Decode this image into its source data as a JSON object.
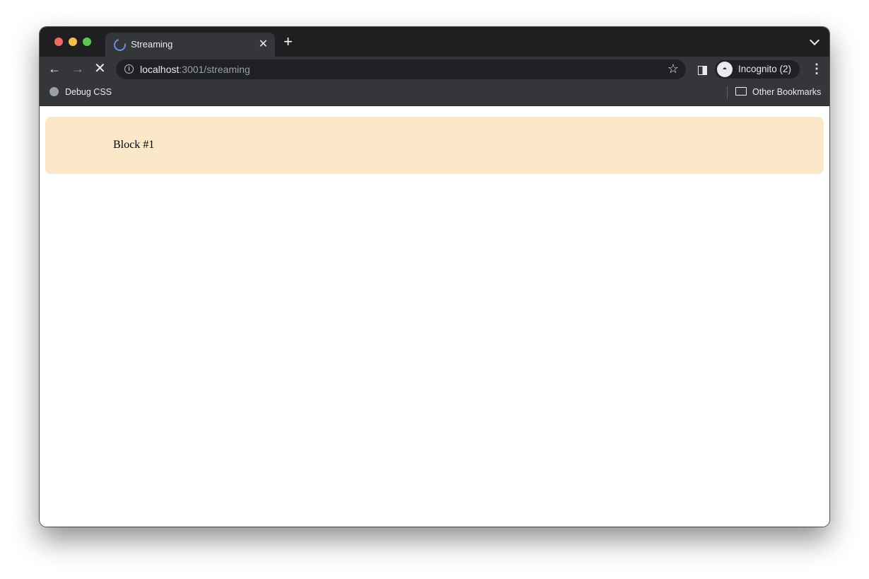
{
  "browser": {
    "tab": {
      "title": "Streaming",
      "loading": true
    },
    "new_tab_label": "+",
    "address_bar": {
      "host": "localhost",
      "rest": ":3001/streaming"
    },
    "profile_label": "Incognito (2)",
    "bookmarks": [
      {
        "label": "Debug CSS",
        "icon": "globe-icon"
      },
      {
        "label": "Other Bookmarks",
        "icon": "folder-icon"
      }
    ]
  },
  "icons": {
    "back": "←",
    "forward": "→",
    "stop": "✕",
    "close": "✕",
    "star": "☆",
    "menu": "⋮",
    "incognito": "👓",
    "info": "i"
  },
  "page": {
    "blocks": [
      {
        "label": "Block #1",
        "background": "#fbe8c8"
      }
    ]
  }
}
